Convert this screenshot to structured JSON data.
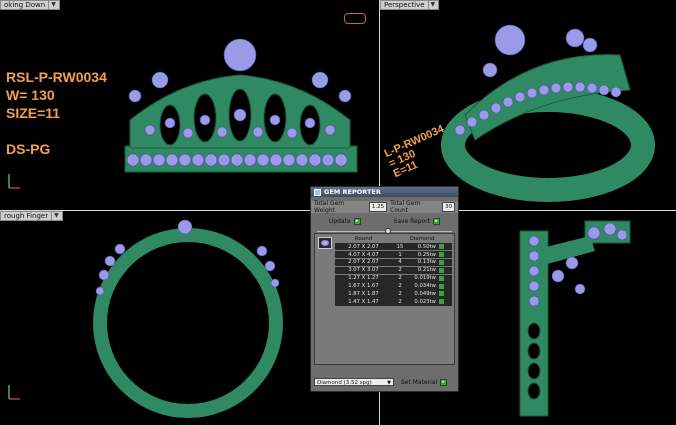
{
  "viewports": {
    "top_left": {
      "label": "oking Down"
    },
    "top_right": {
      "label": "Perspective"
    },
    "bottom_left": {
      "label": "rough Finger"
    },
    "bottom_right": {
      "label": ""
    }
  },
  "ring_info": {
    "code": "RSL-P-RW0034",
    "weight": "W= 130",
    "size": "SIZE=11",
    "finish": "DS-PG"
  },
  "rotated_info": {
    "line1": "L-P-RW0034",
    "line2": "= 130",
    "line3": "E=11"
  },
  "colors": {
    "metal": "#2f8a63",
    "gem": "#9a9ae8",
    "label_text": "#f0a050"
  },
  "gem_reporter": {
    "title": "GEM REPORTER",
    "total_weight_label": "Total Gem Weight",
    "total_weight_value": "1.25",
    "total_count_label": "Total Gem Count",
    "total_count_value": "30",
    "update_label": "Update",
    "save_report_label": "Save Report",
    "col_shape": "Round",
    "col_material": "Diamond",
    "rows": [
      {
        "size": "2.07 X 2.07",
        "count": "15",
        "weight": "0.50tw"
      },
      {
        "size": "4.07 X 4.07",
        "count": "1",
        "weight": "0.25tw"
      },
      {
        "size": "2.07 X 2.07",
        "count": "4",
        "weight": "0.13tw"
      },
      {
        "size": "3.07 X 3.07",
        "count": "2",
        "weight": "0.21tw"
      },
      {
        "size": "1.27 X 1.27",
        "count": "2",
        "weight": "0.019tw"
      },
      {
        "size": "1.67 X 1.67",
        "count": "2",
        "weight": "0.034tw"
      },
      {
        "size": "1.87 X 1.87",
        "count": "2",
        "weight": "0.049tw"
      },
      {
        "size": "1.47 X 1.47",
        "count": "2",
        "weight": "0.023tw"
      }
    ],
    "material_select": "Diamond  (3.52 spg)",
    "set_material_label": "Set Material"
  }
}
